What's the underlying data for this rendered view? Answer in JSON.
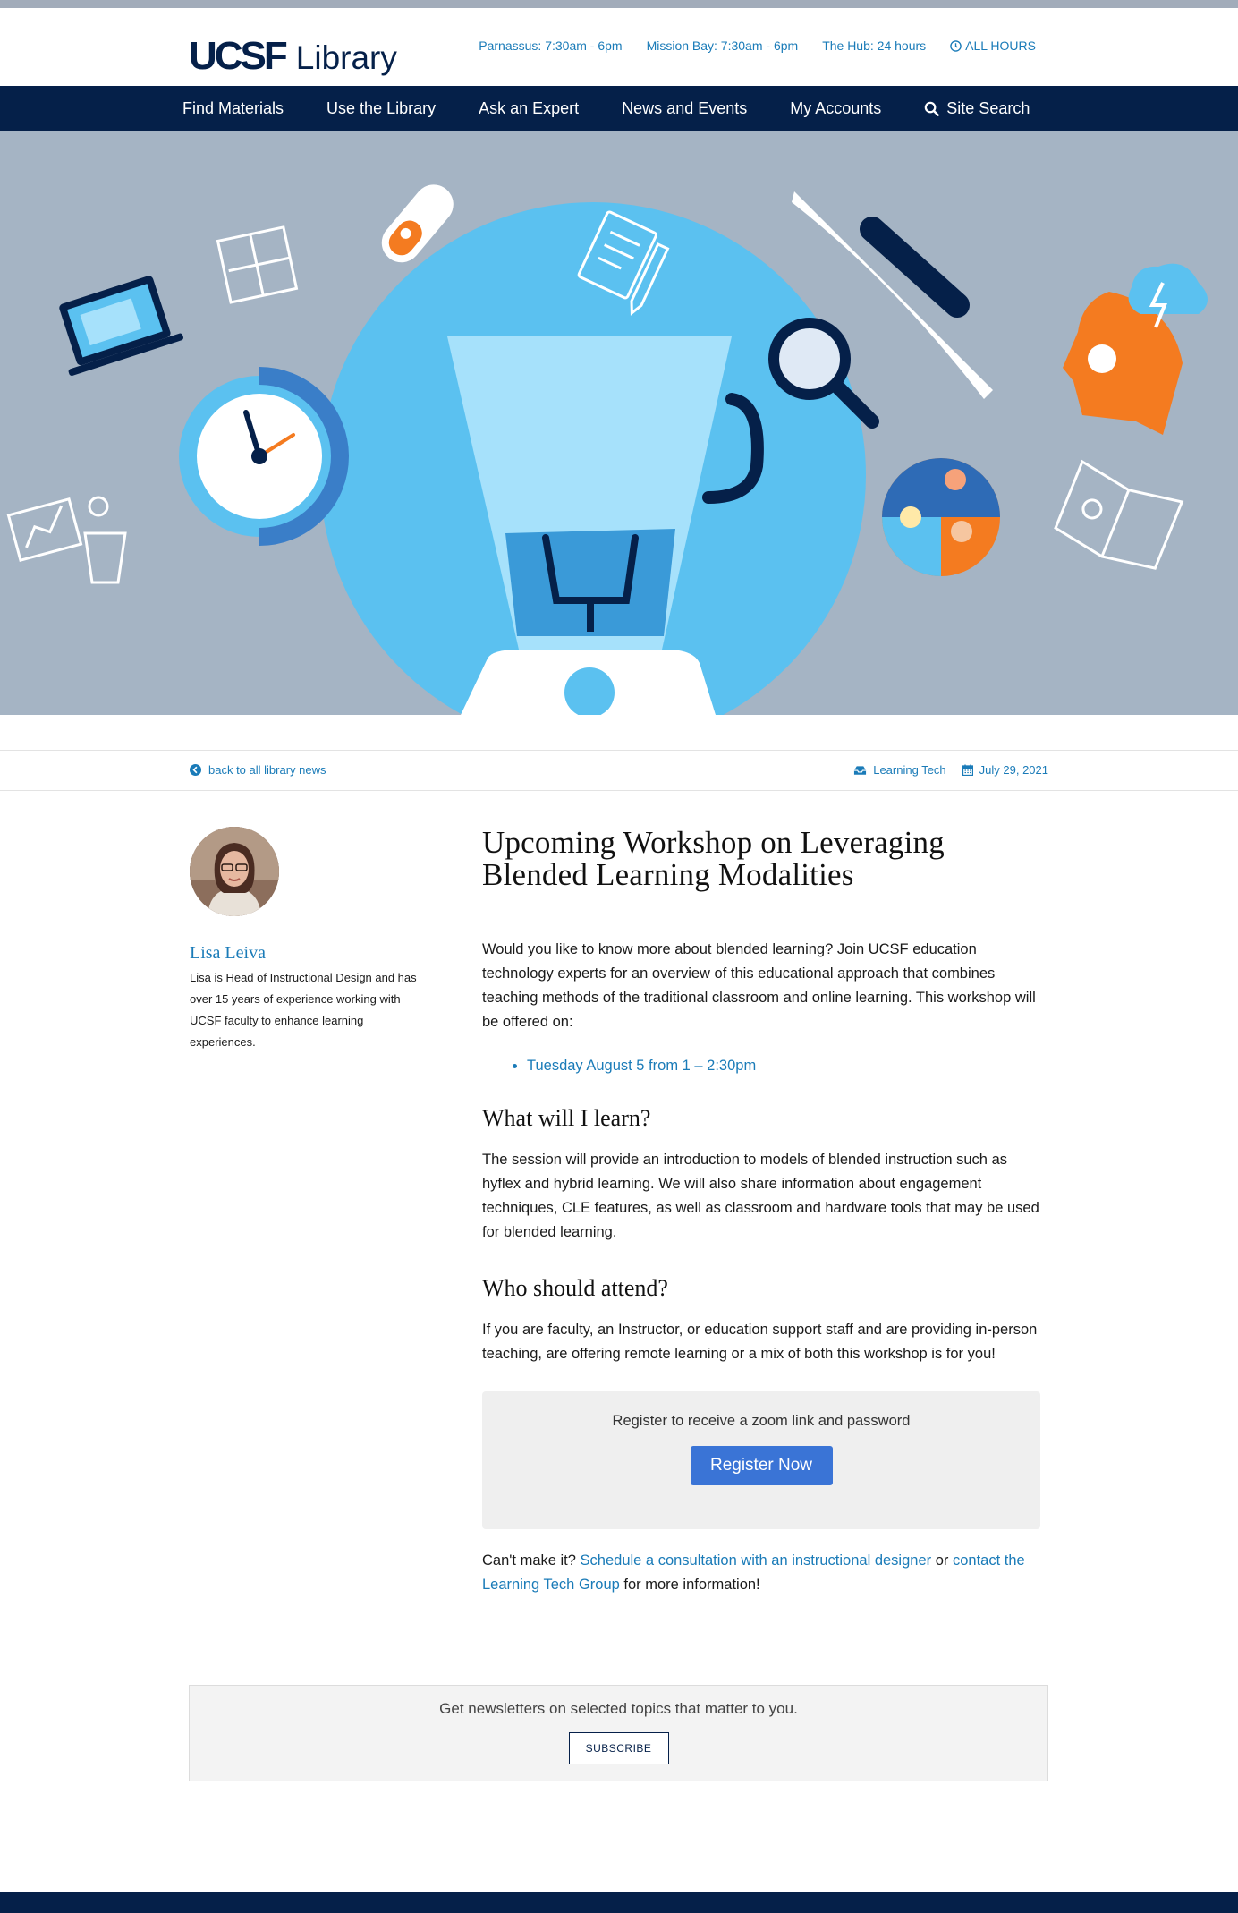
{
  "header": {
    "logo_ucsf": "UCSF",
    "logo_library": "Library",
    "hours": {
      "parnassus": "Parnassus: 7:30am - 6pm",
      "mission_bay": "Mission Bay: 7:30am - 6pm",
      "hub": "The Hub: 24 hours",
      "all_hours": "ALL HOURS"
    }
  },
  "nav": {
    "items": [
      "Find Materials",
      "Use the Library",
      "Ask an Expert",
      "News and Events",
      "My Accounts",
      "Site Search"
    ]
  },
  "meta": {
    "back_link": "back to all library news",
    "category": "Learning Tech",
    "date": "July 29, 2021"
  },
  "author": {
    "name": "Lisa Leiva",
    "bio": "Lisa is Head of Instructional Design and has over 15 years of experience working with UCSF faculty to enhance learning experiences."
  },
  "article": {
    "title": "Upcoming Workshop on Leveraging Blended Learning Modalities",
    "intro": "Would you like to know more about blended learning? Join UCSF education technology experts for an overview of this educational approach that combines teaching methods of the traditional classroom and online learning. This workshop will be offered on:",
    "session": "Tuesday August 5 from 1 – 2:30pm",
    "h_learn": "What will I learn?",
    "p_learn": "The session will provide an introduction to models of blended instruction such as hyflex and hybrid learning. We will also share information about engagement techniques, CLE features, as well as classroom and hardware tools that may be used for blended learning.",
    "h_attend": "Who should attend?",
    "p_attend": "If you are faculty, an Instructor, or education support staff and are providing in-person teaching, are offering remote learning or a mix of both this workshop is for you!",
    "register_text": "Register to receive a zoom link and password",
    "register_button": "Register Now",
    "cant_prefix": "Can't make it?",
    "cant_link1": "Schedule a consultation with an instructional designer",
    "cant_or": "or",
    "cant_link2": "contact the Learning Tech Group",
    "cant_suffix": "for more information!"
  },
  "newsletter": {
    "text": "Get newsletters on selected topics that matter to you.",
    "button": "SUBSCRIBE"
  },
  "colors": {
    "navy": "#052049",
    "link": "#1a7bb8",
    "hero_bg": "#a5b4c4",
    "button": "#3a74d6"
  }
}
